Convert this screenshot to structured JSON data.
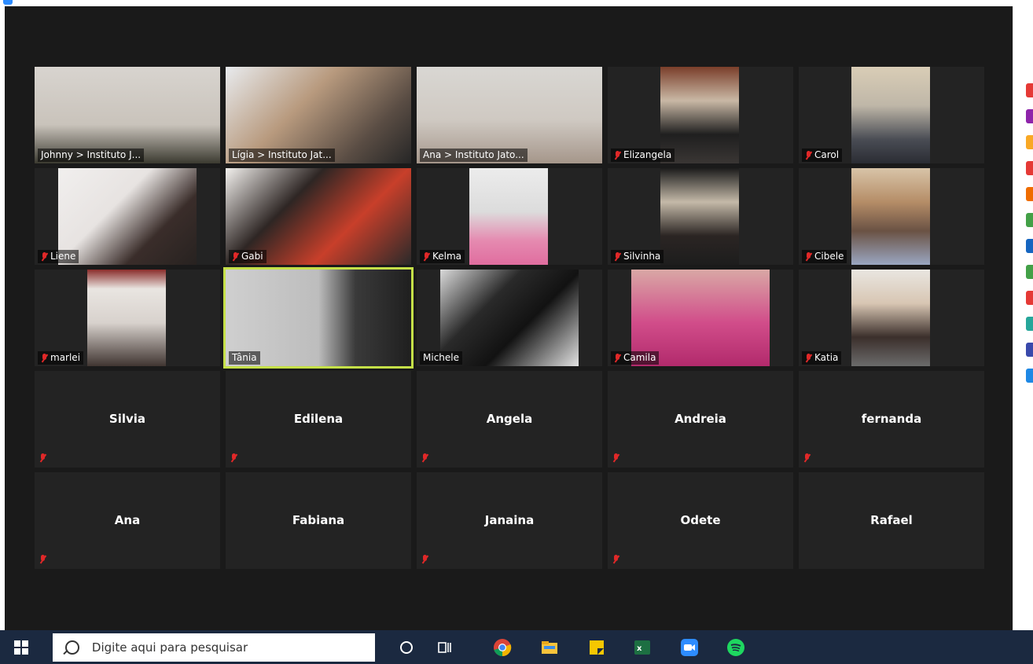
{
  "meeting": {
    "participants_row1": [
      "Johnny > Instituto J...",
      "Lígia > Instituto Jat...",
      "Ana > Instituto Jato...",
      "Elizangela",
      "Carol"
    ],
    "participants_row2": [
      "Liene",
      "Gabi",
      "Kelma",
      "Silvinha",
      "Cibele"
    ],
    "participants_row3": [
      "marlei",
      "Tânia",
      "Michele",
      "Camila",
      "Katia"
    ],
    "participants_row4": [
      "Silvia",
      "Edilena",
      "Angela",
      "Andreia",
      "fernanda"
    ],
    "participants_row5": [
      "Ana",
      "Fabiana",
      "Janaina",
      "Odete",
      "Rafael"
    ],
    "active_speaker": "Tânia",
    "speaker_highlight_color": "#c5e048",
    "muted_color": "#e02828"
  },
  "sidebar": {
    "avatar_colors": [
      "#e53935",
      "#8e24aa",
      "#f9a825",
      "#e53935",
      "#ef6c00",
      "#43a047",
      "#1565c0",
      "#43a047",
      "#e53935",
      "#26a69a",
      "#3949ab",
      "#1e88e5"
    ]
  },
  "taskbar": {
    "search_placeholder": "Digite aqui para pesquisar",
    "apps": [
      "cortana-icon",
      "task-view-icon",
      "chrome-icon",
      "file-explorer-icon",
      "sticky-notes-icon",
      "excel-icon",
      "zoom-icon",
      "spotify-icon"
    ]
  }
}
